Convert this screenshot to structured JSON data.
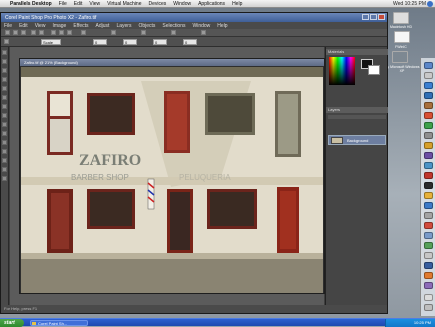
{
  "mac_menubar": {
    "app_name": "Parallels Desktop",
    "items": [
      "File",
      "Edit",
      "View",
      "Virtual Machine",
      "Devices",
      "Window",
      "Applications",
      "Help"
    ],
    "clock": "Wed 10:25 PM"
  },
  "window": {
    "title": "Corel Paint Shop Pro Photo X2 - Zafiro.tif",
    "menu": [
      "File",
      "Edit",
      "View",
      "Image",
      "Effects",
      "Adjust",
      "Layers",
      "Objects",
      "Selections",
      "Window",
      "Help"
    ]
  },
  "toolbar": {
    "zoom_value": "Scale",
    "fields": [
      "0",
      "0",
      "0",
      "0"
    ]
  },
  "document": {
    "title": "Zafiro.tif  @  21% (Background)",
    "photo_text_main": "ZAFIRO",
    "photo_text_sub": "BARBER SHOP",
    "photo_text_sub2": "PELUQUERIA"
  },
  "palettes": {
    "materials_header": "Materials",
    "layers_header": "Layers",
    "layer_name": "Background"
  },
  "statusbar": {
    "text": "For Help, press F1"
  },
  "desktop_icons": [
    {
      "label": "Macintosh HD"
    },
    {
      "label": "FWinIC"
    },
    {
      "label": "My Microsoft Windows XP"
    }
  ],
  "taskbar": {
    "start_label": "start",
    "task_label": "Corel Paint Sh...",
    "tray_time": "10:25 PM"
  }
}
